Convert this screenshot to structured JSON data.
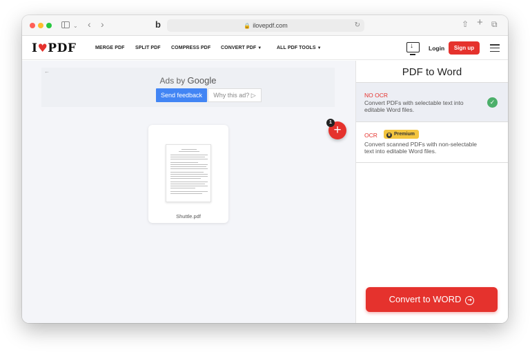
{
  "browser": {
    "url": "ilovepdf.com"
  },
  "brand": {
    "logo_text": "I",
    "logo_text_after": "PDF",
    "accent_color": "#e5322d"
  },
  "nav": {
    "items": [
      "MERGE PDF",
      "SPLIT PDF",
      "COMPRESS PDF",
      "CONVERT PDF",
      "ALL PDF TOOLS"
    ],
    "login": "Login",
    "signup": "Sign up"
  },
  "ad": {
    "ads_by": "Ads by",
    "google": "Google",
    "feedback": "Send feedback",
    "why": "Why this ad? ▷"
  },
  "files": {
    "count": "1",
    "name": "Shuttle.pdf"
  },
  "sidebar": {
    "title": "PDF to Word",
    "options": [
      {
        "title": "NO OCR",
        "description": "Convert PDFs with selectable text into editable Word files.",
        "selected": true
      },
      {
        "title": "OCR",
        "badge": "Premium",
        "description": "Convert scanned PDFs with non-selectable text into editable Word files.",
        "selected": false
      }
    ],
    "convert_button": "Convert to WORD"
  }
}
